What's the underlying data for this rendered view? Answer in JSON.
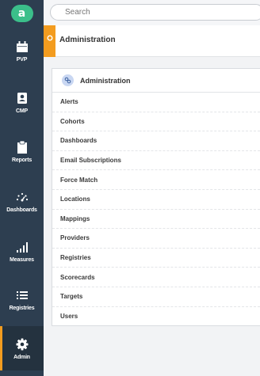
{
  "sidebar": {
    "logo": "a",
    "items": [
      {
        "label": "PVP",
        "icon": "calendar-icon"
      },
      {
        "label": "CMP",
        "icon": "id-card-icon"
      },
      {
        "label": "Reports",
        "icon": "clipboard-icon"
      },
      {
        "label": "Dashboards",
        "icon": "gauge-icon"
      },
      {
        "label": "Measures",
        "icon": "bar-chart-icon"
      },
      {
        "label": "Registries",
        "icon": "list-icon"
      },
      {
        "label": "Admin",
        "icon": "gear-icon",
        "active": true
      }
    ]
  },
  "search": {
    "placeholder": "Search"
  },
  "header": {
    "title": "Administration"
  },
  "card": {
    "title": "Administration",
    "items": [
      "Alerts",
      "Cohorts",
      "Dashboards",
      "Email Subscriptions",
      "Force Match",
      "Locations",
      "Mappings",
      "Providers",
      "Registries",
      "Scorecards",
      "Targets",
      "Users"
    ]
  },
  "colors": {
    "sidebar": "#2d3e50",
    "accent": "#f39c1f",
    "logo": "#3bbf8a"
  }
}
